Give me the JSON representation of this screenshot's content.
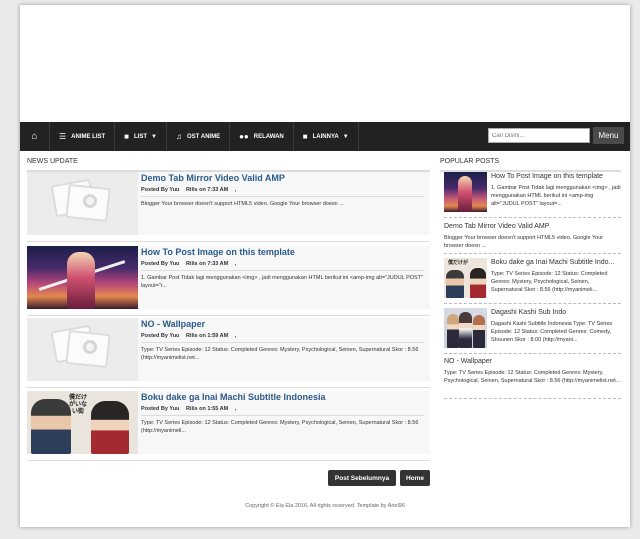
{
  "nav": {
    "items": [
      {
        "label": "",
        "icon": "home-icon"
      },
      {
        "label": "ANIME LIST",
        "icon": "list-icon"
      },
      {
        "label": "LIST",
        "icon": "folder-icon",
        "dropdown": true
      },
      {
        "label": "OST ANIME",
        "icon": "music-icon"
      },
      {
        "label": "RELAWAN",
        "icon": "users-icon"
      },
      {
        "label": "LAINNYA",
        "icon": "folder-icon",
        "dropdown": true
      }
    ],
    "search_placeholder": "Cari Disini...",
    "menu_label": "Menu"
  },
  "main": {
    "section_title": "NEWS UPDATE",
    "posts": [
      {
        "title": "Demo Tab Mirror Video Valid AMP",
        "author": "Posted By Yuu",
        "time": "Rilis on 7:33 AM",
        "sep": ",",
        "snippet": "Blogger Your browser doesn't support HTML5 video. Google Your browser doesn ...",
        "thumb": "placeholder"
      },
      {
        "title": "How To Post Image on this template",
        "author": "Posted By Yuu",
        "time": "Rilis on 7:33 AM",
        "sep": ",",
        "snippet": "1. Gambar Post Tidak lagi menggunakan <img> , jadi menggunakan HTML berikut ini <amp-img alt=\"JUDUL POST\" layout=\"r...",
        "thumb": "sunset-anime"
      },
      {
        "title": "NO - Wallpaper",
        "author": "Posted By Yuu",
        "time": "Rilis on 1:59 AM",
        "sep": ",",
        "snippet": "Type: TV Series Episode: 12 Status: Completed Genres: Mystery, Psychological, Seinen, Supernatural Skor : 8.56 (http://myanimelist.net...",
        "thumb": "placeholder"
      },
      {
        "title": "Boku dake ga Inai Machi Subtitle Indonesia",
        "author": "Posted By Yuu",
        "time": "Rilis on 1:55 AM",
        "sep": ",",
        "snippet": "Type: TV Series Episode: 12 Status: Completed Genres: Mystery, Psychological, Seinen, Supernatural Skor : 8.56 (http://myanimeli...",
        "thumb": "boku-dake"
      }
    ],
    "prev_button": "Post Sebelumnya",
    "home_button": "Home"
  },
  "sidebar": {
    "section_title": "POPULAR POSTS",
    "posts": [
      {
        "title": "How To Post Image on this template",
        "snippet": "1. Gambar Post Tidak lagi menggunakan <img> , jadi menggunakan HTML berikut ini <amp-img alt=\"JUDUL POST\" layout=...",
        "thumb": "sunset-anime"
      },
      {
        "title": "Demo Tab Mirror Video Valid AMP",
        "snippet": "Blogger Your browser doesn't support HTML5 video. Google Your browser doesn ...",
        "thumb": ""
      },
      {
        "title": "Boku dake ga Inai Machi Subtitle Indo...",
        "snippet": "Type: TV Series Episode: 12 Status: Completed Genres: Mystery, Psychological, Seinen, Supernatural Skor : 8.56 (http://myanimeli...",
        "thumb": "boku-dake"
      },
      {
        "title": "Dagashi Kashi Sub Indo",
        "snippet": "Dagashi Kashi Subtitle Indonesia Type: TV Series Episode: 12 Status: Completed Genres: Comedy, Shounen Skor : 8.00 (http://myani...",
        "thumb": "dagashi"
      },
      {
        "title": "NO - Wallpaper",
        "snippet": "Type: TV Series Episode: 12 Status: Completed Genres: Mystery, Psychological, Seinen, Supernatural Skor : 8.56 (http://myanimelist.net...",
        "thumb": ""
      }
    ]
  },
  "footer": {
    "text": "Copyright © Ela Ela 2016, All rights reserved. Template by Ariel96"
  },
  "thumb_texts": {
    "boku_large": "僕だけがいない街",
    "boku_small": "僕だけが"
  },
  "colors": {
    "nav_bg": "#222222",
    "title_link": "#2b5b8a",
    "button_bg": "#333333",
    "page_bg": "#eaeaea"
  }
}
